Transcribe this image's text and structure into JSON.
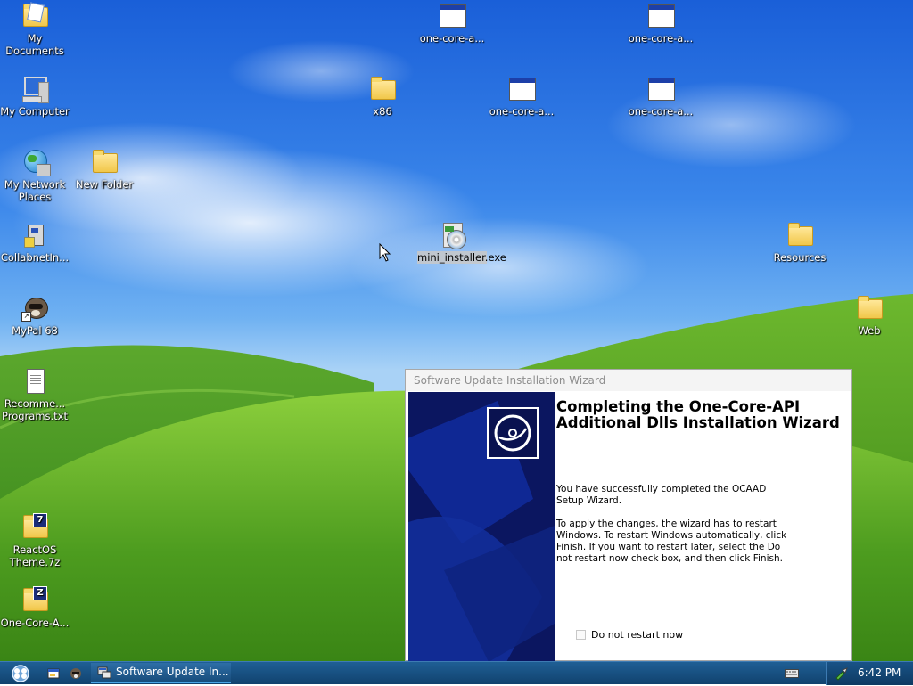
{
  "desktop": {
    "icons": [
      {
        "label": "My Documents",
        "type": "folder"
      },
      {
        "label": "My Computer",
        "type": "computer"
      },
      {
        "label": "My Network Places",
        "type": "network"
      },
      {
        "label": "New Folder",
        "type": "folder"
      },
      {
        "label": "CollabnetIn...",
        "type": "installer"
      },
      {
        "label": "MyPal 68",
        "type": "shortcut"
      },
      {
        "label": "Recomme... Programs.txt",
        "type": "text-file"
      },
      {
        "label": "ReactOS Theme.7z",
        "type": "archive"
      },
      {
        "label": "One-Core-A...",
        "type": "archive"
      },
      {
        "label": "one-core-a...",
        "type": "application"
      },
      {
        "label": "one-core-a...",
        "type": "application"
      },
      {
        "label": "x86",
        "type": "folder"
      },
      {
        "label": "one-core-a...",
        "type": "application"
      },
      {
        "label": "one-core-a...",
        "type": "application"
      },
      {
        "label": "mini_installer.exe",
        "type": "installer"
      },
      {
        "label": "Resources",
        "type": "folder"
      },
      {
        "label": "Web",
        "type": "folder"
      }
    ]
  },
  "wizard": {
    "title": "Software Update Installation Wizard",
    "heading": "Completing the One-Core-API Additional Dlls Installation Wizard",
    "paragraph1": "You have successfully completed the OCAAD Setup Wizard.",
    "paragraph2": "To apply the changes, the wizard has to restart Windows. To restart Windows automatically, click Finish. If you want to restart later, select the Do not restart now check box, and then click Finish.",
    "checkbox_label": "Do not restart now",
    "checkbox_checked": false
  },
  "taskbar": {
    "task_button_label": "Software Update In...",
    "clock": "6:42 PM"
  },
  "colors": {
    "taskbar": "#164e80",
    "wizard_side_panel": "#0b1660",
    "task_active_underline": "#4aa6e8"
  }
}
